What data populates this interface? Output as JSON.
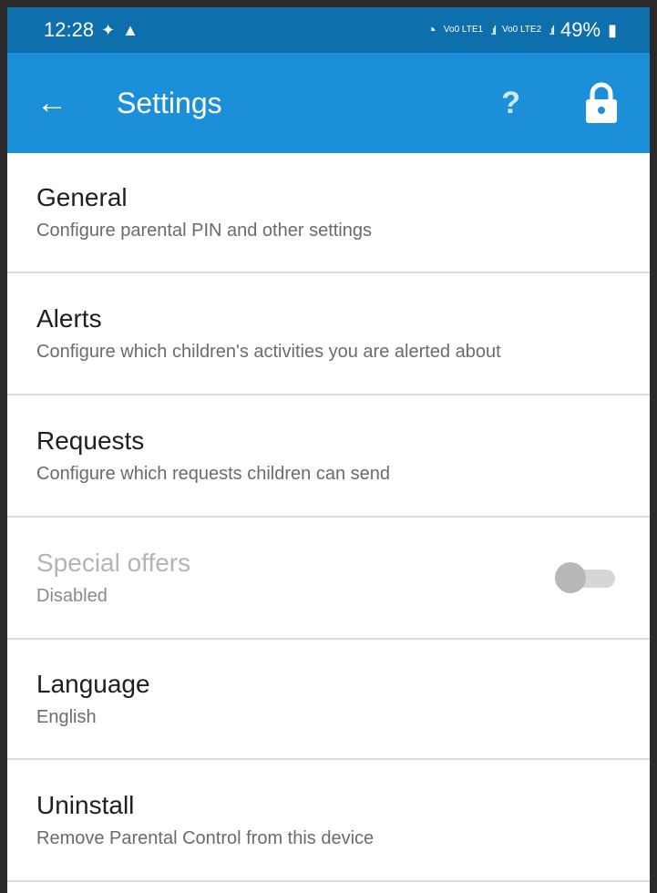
{
  "status_bar": {
    "time": "12:28",
    "notif_icons": [
      "cast-icon",
      "warning-icon"
    ],
    "network_label_1": "Vo0 LTE1",
    "network_label_2": "Vo0 LTE2",
    "battery": "49%"
  },
  "app_bar": {
    "title": "Settings",
    "help_label": "?",
    "bg_color": "#1c8fd9",
    "status_color": "#0e6fad"
  },
  "settings": [
    {
      "title": "General",
      "subtitle": "Configure parental PIN and other settings"
    },
    {
      "title": "Alerts",
      "subtitle": "Configure which children's activities you are alerted about"
    },
    {
      "title": "Requests",
      "subtitle": "Configure which requests children can send"
    },
    {
      "title": "Special offers",
      "subtitle": "Disabled",
      "toggle_on": false,
      "disabled": true
    },
    {
      "title": "Language",
      "subtitle": "English"
    },
    {
      "title": "Uninstall",
      "subtitle": "Remove Parental Control from this device"
    }
  ]
}
